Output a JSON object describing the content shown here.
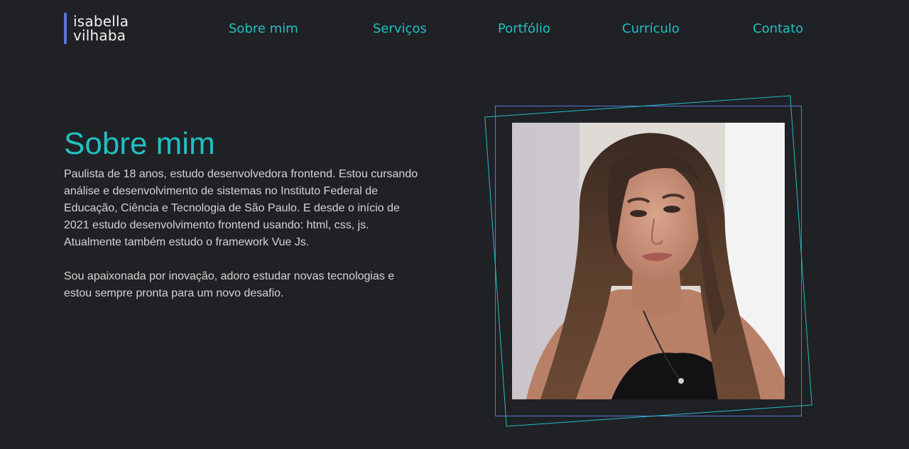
{
  "logo": {
    "line1": "isabella",
    "line2": "vilhaba",
    "accent_color": "#5b74d8"
  },
  "nav": {
    "items": [
      {
        "label": "Sobre mim"
      },
      {
        "label": "Serviços"
      },
      {
        "label": "Portfólio"
      },
      {
        "label": "Currículo"
      },
      {
        "label": "Contato"
      }
    ],
    "color": "#22bfc2"
  },
  "about": {
    "title": "Sobre mim",
    "paragraphs": [
      "Paulista de 18 anos, estudo desenvolvedora frontend. Estou cursando análise e desenvolvimento de sistemas no Instituto Federal de Educação, Ciência e Tecnologia de São Paulo. E desde o início de 2021 estudo desenvolvimento frontend usando: html, css, js. Atualmente também estudo o framework Vue Js.",
      "Sou apaixonada por inovação, adoro estudar novas tecnologias e estou sempre pronta para um novo desafio."
    ]
  },
  "photo": {
    "subject": "portrait photo of a young woman with long brown hair",
    "frame_colors": [
      "#5b74d8",
      "#22bfc2"
    ]
  },
  "theme": {
    "background": "#1f2125",
    "accent": "#22bfc2",
    "text": "#d4d4d4"
  }
}
